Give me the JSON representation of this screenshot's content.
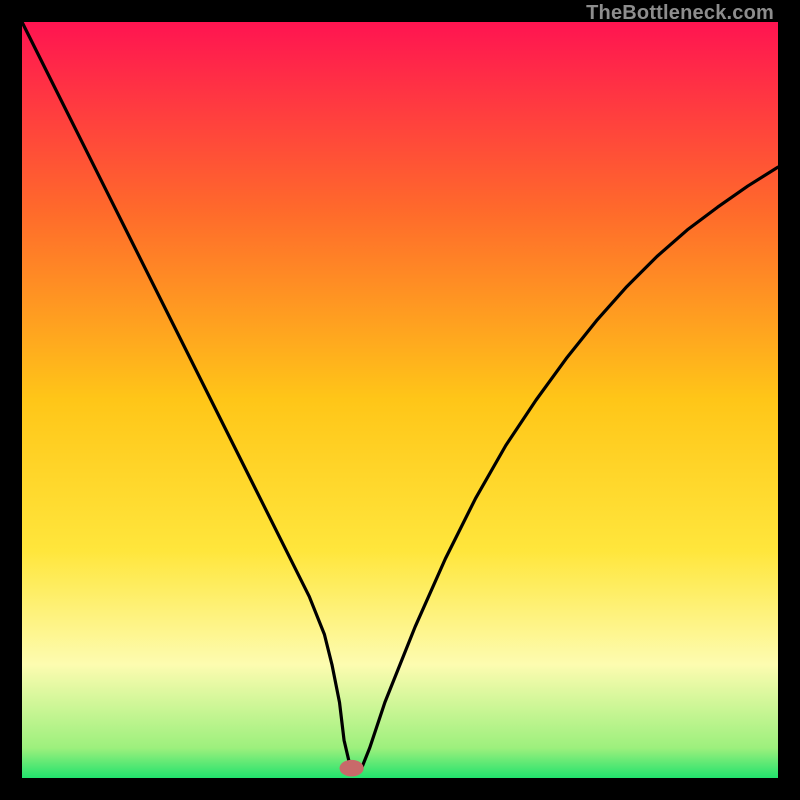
{
  "watermark": "TheBottleneck.com",
  "chart_data": {
    "type": "line",
    "title": "",
    "xlabel": "",
    "ylabel": "",
    "xlim": [
      0,
      100
    ],
    "ylim": [
      0,
      100
    ],
    "grid": false,
    "legend": false,
    "gradient_stops": [
      {
        "offset": 0,
        "color": "#ff1451"
      },
      {
        "offset": 25,
        "color": "#ff6a2b"
      },
      {
        "offset": 50,
        "color": "#ffc618"
      },
      {
        "offset": 70,
        "color": "#ffe63c"
      },
      {
        "offset": 85,
        "color": "#fdfcb0"
      },
      {
        "offset": 96,
        "color": "#9df07d"
      },
      {
        "offset": 100,
        "color": "#22e26d"
      }
    ],
    "series": [
      {
        "name": "bottleneck-curve",
        "color": "#000000",
        "stroke_width": 3.2,
        "x": [
          0,
          4,
          8,
          12,
          16,
          20,
          24,
          28,
          32,
          36,
          38,
          40,
          41,
          42,
          42.6,
          43.3,
          44,
          44.5,
          45,
          46,
          48,
          52,
          56,
          60,
          64,
          68,
          72,
          76,
          80,
          84,
          88,
          92,
          96,
          100
        ],
        "values": [
          100,
          92,
          84,
          76,
          68,
          60,
          52,
          44,
          36,
          28,
          24,
          19,
          15,
          10,
          5,
          2,
          1,
          1,
          1.5,
          4,
          10,
          20,
          29,
          37,
          44,
          50,
          55.5,
          60.5,
          65,
          69,
          72.5,
          75.5,
          78.3,
          80.8
        ]
      }
    ],
    "marker": {
      "name": "selected-point",
      "x": 43.6,
      "y": 1.3,
      "rx": 1.6,
      "ry": 1.1,
      "fill": "#c86a6a"
    }
  }
}
